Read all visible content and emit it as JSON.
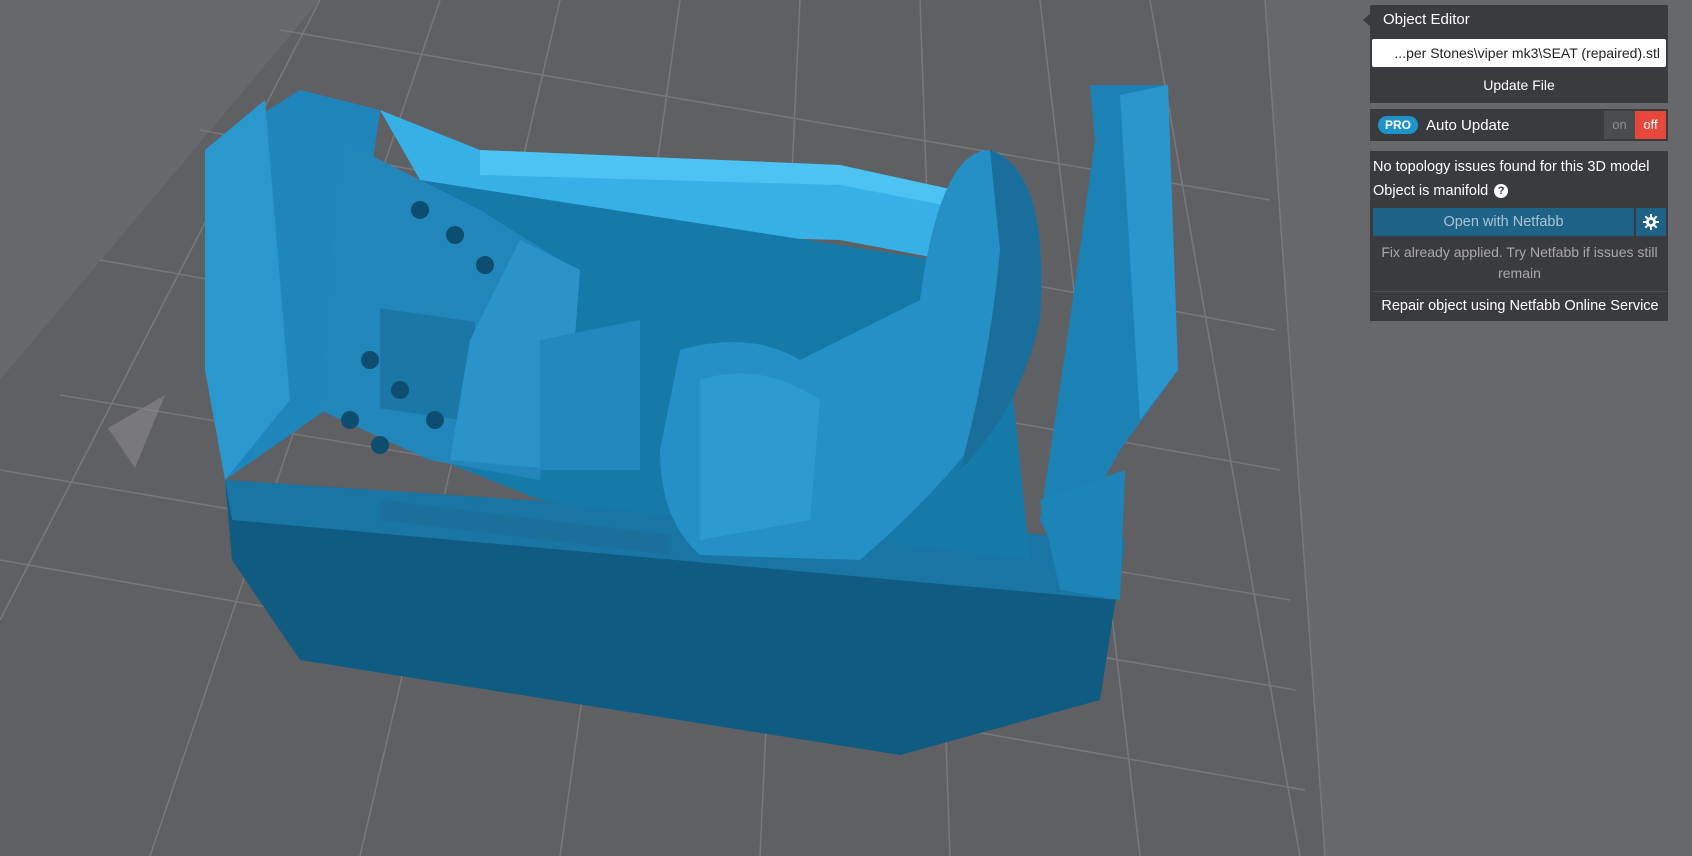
{
  "object_editor": {
    "title": "Object Editor",
    "file_path_value": "...per Stones\\viper mk3\\SEAT (repaired).stl",
    "update_file_label": "Update File"
  },
  "auto_update": {
    "badge": "PRO",
    "label": "Auto Update",
    "on_label": "on",
    "off_label": "off",
    "state": "off"
  },
  "topology": {
    "status": "No topology issues found for this 3D model",
    "manifold": "Object is manifold",
    "help_icon_glyph": "?",
    "open_netfabb_label": "Open with Netfabb",
    "fix_note": "Fix already applied. Try Netfabb if issues still remain",
    "repair_label": "Repair object using Netfabb Online Service"
  },
  "icons": {
    "help": "question-circle-icon",
    "settings": "gear-icon"
  },
  "colors": {
    "model": "#2a9ad0",
    "background": "#67686c",
    "panel": "#3a3b3e",
    "accent": "#1d93c8",
    "toggle_off": "#e8473c"
  }
}
